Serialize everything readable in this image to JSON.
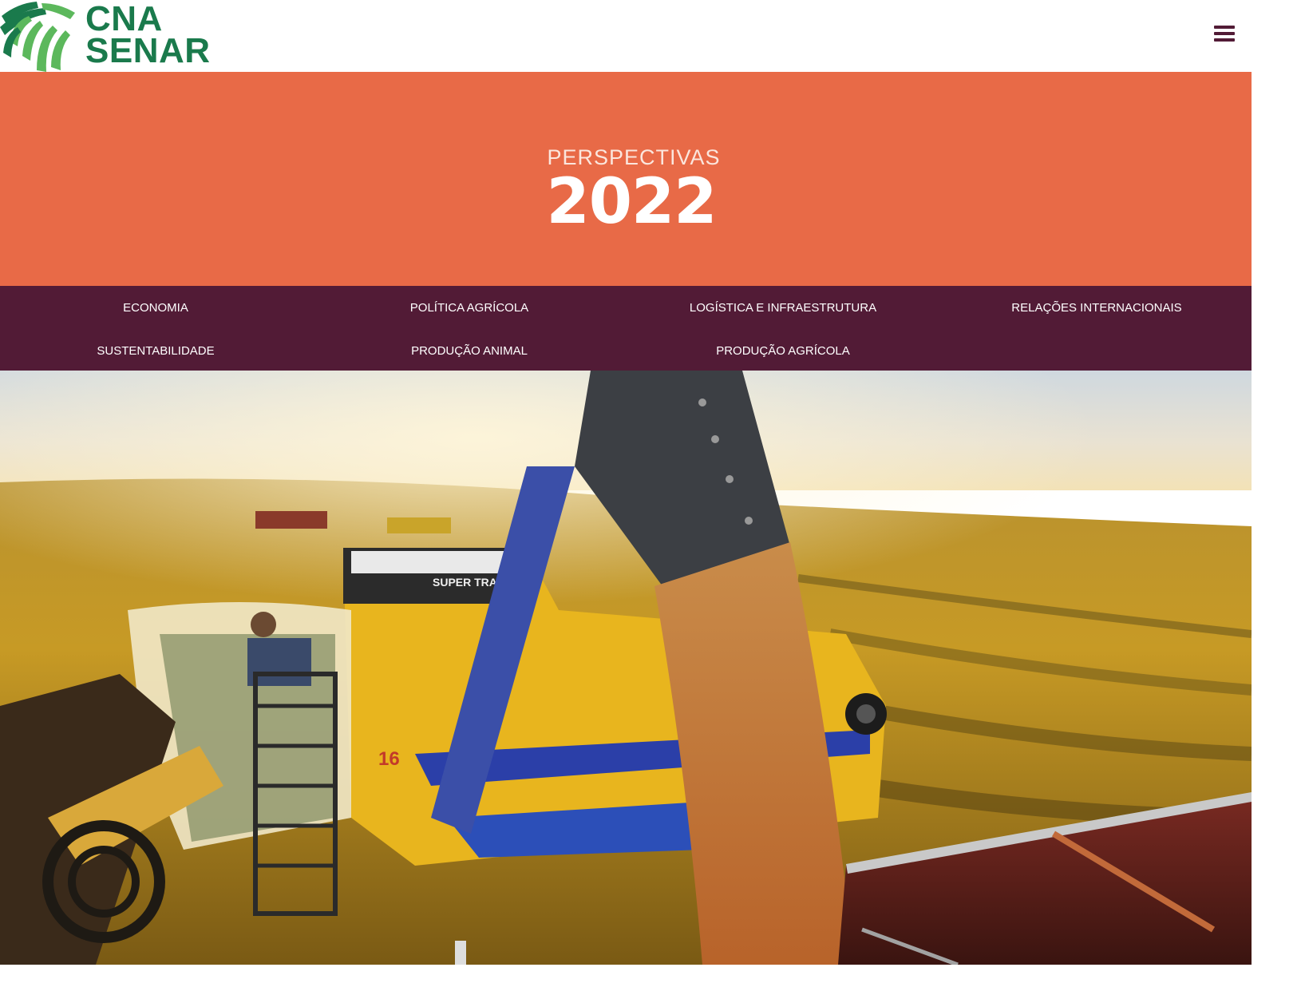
{
  "header": {
    "logo_line1": "CNA",
    "logo_line2": "SENAR",
    "menu_icon": "hamburger-menu-icon"
  },
  "hero": {
    "kicker": "PERSPECTIVAS",
    "year": "2022"
  },
  "nav": {
    "items": [
      {
        "label": "ECONOMIA"
      },
      {
        "label": "POLÍTICA AGRÍCOLA"
      },
      {
        "label": "LOGÍSTICA E INFRAESTRUTURA"
      },
      {
        "label": "RELAÇÕES INTERNACIONAIS"
      },
      {
        "label": "SUSTENTABILIDADE"
      },
      {
        "label": "PRODUÇÃO ANIMAL"
      },
      {
        "label": "PRODUÇÃO AGRÍCOLA"
      }
    ]
  },
  "photo": {
    "subject": "combine-harvester-unloading-grain",
    "machine_brand": "SUPER TRATORES",
    "machine_number": "16"
  },
  "colors": {
    "logo_green": "#1a7a4c",
    "logo_light_green": "#5cb85c",
    "hero_orange": "#e86a47",
    "nav_purple": "#521b36",
    "menu_icon": "#521b36"
  }
}
